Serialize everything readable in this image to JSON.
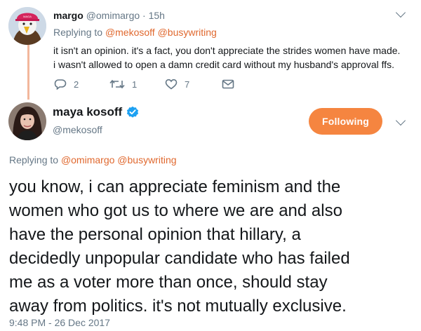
{
  "reply_tweet": {
    "display_name": "margo",
    "handle": "@omimargo",
    "separator": "·",
    "time": "15h",
    "replying_label": "Replying to",
    "replying_to": [
      "@mekosoff",
      "@busywriting"
    ],
    "text_lines": [
      "it isn't an opinion. it's a fact, you don't appreciate the strides women have made.",
      "i wasn't allowed to open a damn credit card without my husband's approval ffs."
    ],
    "actions": {
      "reply_icon": "reply-icon",
      "reply_count": "2",
      "retweet_icon": "retweet-icon",
      "retweet_count": "1",
      "like_icon": "heart-icon",
      "like_count": "7",
      "dm_icon": "envelope-icon"
    }
  },
  "main_tweet": {
    "display_name": "maya kosoff",
    "verified_icon": "verified-badge-icon",
    "handle": "@mekosoff",
    "follow_label": "Following",
    "replying_label": "Replying to",
    "replying_to": [
      "@omimargo",
      "@busywriting"
    ],
    "text_lines": [
      "you know, i can appreciate feminism and the",
      "women who got us to where we are and also",
      "have the personal opinion that hillary, a",
      "decidedly unpopular candidate who has failed",
      "me as a voter more than once, should stay",
      "away from politics. it's not mutually exclusive."
    ],
    "timestamp": "9:48 PM - 26 Dec 2017"
  },
  "colors": {
    "accent": "#e0682e",
    "follow_button": "#f58540",
    "muted": "#657786",
    "verified": "#1da1f2"
  }
}
